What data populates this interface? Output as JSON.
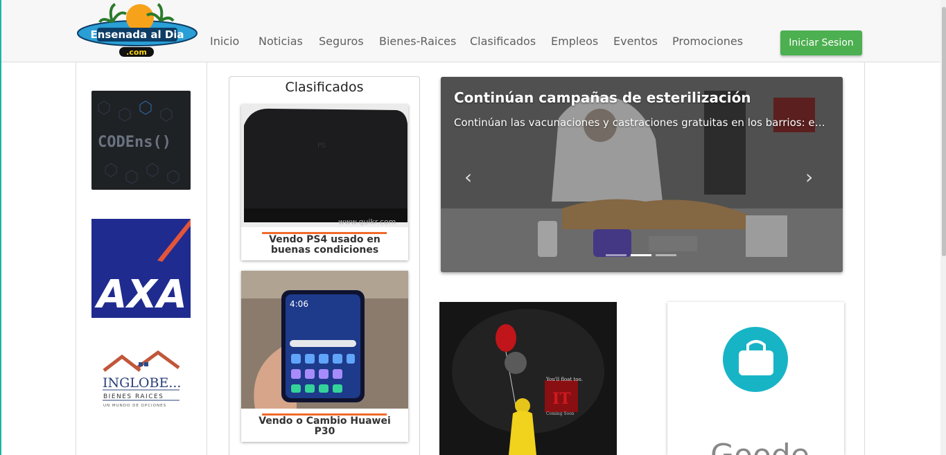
{
  "header": {
    "logo_text": "Ensenada al Dia",
    "logo_domain": ".com",
    "nav": [
      "Inicio",
      "Noticias",
      "Seguros",
      "Bienes-Raices",
      "Clasificados",
      "Empleos",
      "Eventos",
      "Promociones"
    ],
    "login_label": "Iniciar Sesion"
  },
  "sidebar": {
    "ads": [
      {
        "name": "CODEns()"
      },
      {
        "name": "AXA"
      },
      {
        "name": "INGLOBE...",
        "line2": "BIENES RAICES",
        "line3": "UN MUNDO DE OPCIONES"
      }
    ]
  },
  "clasificados": {
    "title": "Clasificados",
    "items": [
      {
        "caption": "Vendo PS4 usado en buenas condiciones",
        "watermark": "www.quikr.com"
      },
      {
        "caption": "Vendo o Cambio Huawei P30",
        "phone_time": "4:06"
      }
    ]
  },
  "carousel": {
    "title": "Continúan campañas de esterilización",
    "subtitle": "Continúan las vacunaciones y castraciones gratuitas en los barrios: en ...",
    "slide_count": 3,
    "active_index": 1
  },
  "movie": {
    "tagline": "You'll float too.",
    "title": "IT",
    "coming": "Coming Soon"
  },
  "app_card": {
    "icon": "shopping-bag-icon",
    "partial_text": "Goode"
  },
  "colors": {
    "accent": "#4caf50",
    "orange": "#f06a2a",
    "teal_border": "#19b6a6"
  }
}
